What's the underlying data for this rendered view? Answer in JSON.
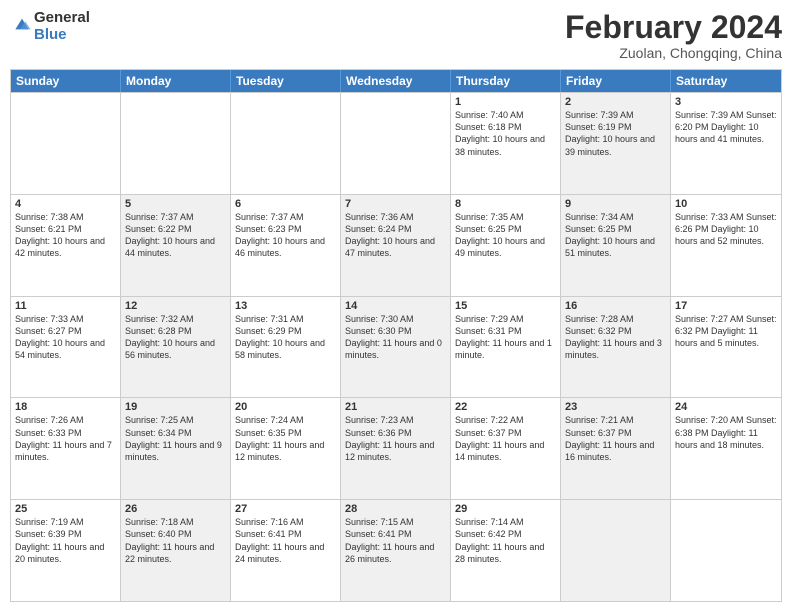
{
  "header": {
    "logo_general": "General",
    "logo_blue": "Blue",
    "title": "February 2024",
    "subtitle": "Zuolan, Chongqing, China"
  },
  "days_of_week": [
    "Sunday",
    "Monday",
    "Tuesday",
    "Wednesday",
    "Thursday",
    "Friday",
    "Saturday"
  ],
  "rows": [
    [
      {
        "day": "",
        "info": "",
        "shaded": false
      },
      {
        "day": "",
        "info": "",
        "shaded": false
      },
      {
        "day": "",
        "info": "",
        "shaded": false
      },
      {
        "day": "",
        "info": "",
        "shaded": false
      },
      {
        "day": "1",
        "info": "Sunrise: 7:40 AM\nSunset: 6:18 PM\nDaylight: 10 hours and 38 minutes.",
        "shaded": false
      },
      {
        "day": "2",
        "info": "Sunrise: 7:39 AM\nSunset: 6:19 PM\nDaylight: 10 hours and 39 minutes.",
        "shaded": true
      },
      {
        "day": "3",
        "info": "Sunrise: 7:39 AM\nSunset: 6:20 PM\nDaylight: 10 hours and 41 minutes.",
        "shaded": false
      }
    ],
    [
      {
        "day": "4",
        "info": "Sunrise: 7:38 AM\nSunset: 6:21 PM\nDaylight: 10 hours and 42 minutes.",
        "shaded": false
      },
      {
        "day": "5",
        "info": "Sunrise: 7:37 AM\nSunset: 6:22 PM\nDaylight: 10 hours and 44 minutes.",
        "shaded": true
      },
      {
        "day": "6",
        "info": "Sunrise: 7:37 AM\nSunset: 6:23 PM\nDaylight: 10 hours and 46 minutes.",
        "shaded": false
      },
      {
        "day": "7",
        "info": "Sunrise: 7:36 AM\nSunset: 6:24 PM\nDaylight: 10 hours and 47 minutes.",
        "shaded": true
      },
      {
        "day": "8",
        "info": "Sunrise: 7:35 AM\nSunset: 6:25 PM\nDaylight: 10 hours and 49 minutes.",
        "shaded": false
      },
      {
        "day": "9",
        "info": "Sunrise: 7:34 AM\nSunset: 6:25 PM\nDaylight: 10 hours and 51 minutes.",
        "shaded": true
      },
      {
        "day": "10",
        "info": "Sunrise: 7:33 AM\nSunset: 6:26 PM\nDaylight: 10 hours and 52 minutes.",
        "shaded": false
      }
    ],
    [
      {
        "day": "11",
        "info": "Sunrise: 7:33 AM\nSunset: 6:27 PM\nDaylight: 10 hours and 54 minutes.",
        "shaded": false
      },
      {
        "day": "12",
        "info": "Sunrise: 7:32 AM\nSunset: 6:28 PM\nDaylight: 10 hours and 56 minutes.",
        "shaded": true
      },
      {
        "day": "13",
        "info": "Sunrise: 7:31 AM\nSunset: 6:29 PM\nDaylight: 10 hours and 58 minutes.",
        "shaded": false
      },
      {
        "day": "14",
        "info": "Sunrise: 7:30 AM\nSunset: 6:30 PM\nDaylight: 11 hours and 0 minutes.",
        "shaded": true
      },
      {
        "day": "15",
        "info": "Sunrise: 7:29 AM\nSunset: 6:31 PM\nDaylight: 11 hours and 1 minute.",
        "shaded": false
      },
      {
        "day": "16",
        "info": "Sunrise: 7:28 AM\nSunset: 6:32 PM\nDaylight: 11 hours and 3 minutes.",
        "shaded": true
      },
      {
        "day": "17",
        "info": "Sunrise: 7:27 AM\nSunset: 6:32 PM\nDaylight: 11 hours and 5 minutes.",
        "shaded": false
      }
    ],
    [
      {
        "day": "18",
        "info": "Sunrise: 7:26 AM\nSunset: 6:33 PM\nDaylight: 11 hours and 7 minutes.",
        "shaded": false
      },
      {
        "day": "19",
        "info": "Sunrise: 7:25 AM\nSunset: 6:34 PM\nDaylight: 11 hours and 9 minutes.",
        "shaded": true
      },
      {
        "day": "20",
        "info": "Sunrise: 7:24 AM\nSunset: 6:35 PM\nDaylight: 11 hours and 12 minutes.",
        "shaded": false
      },
      {
        "day": "21",
        "info": "Sunrise: 7:23 AM\nSunset: 6:36 PM\nDaylight: 11 hours and 12 minutes.",
        "shaded": true
      },
      {
        "day": "22",
        "info": "Sunrise: 7:22 AM\nSunset: 6:37 PM\nDaylight: 11 hours and 14 minutes.",
        "shaded": false
      },
      {
        "day": "23",
        "info": "Sunrise: 7:21 AM\nSunset: 6:37 PM\nDaylight: 11 hours and 16 minutes.",
        "shaded": true
      },
      {
        "day": "24",
        "info": "Sunrise: 7:20 AM\nSunset: 6:38 PM\nDaylight: 11 hours and 18 minutes.",
        "shaded": false
      }
    ],
    [
      {
        "day": "25",
        "info": "Sunrise: 7:19 AM\nSunset: 6:39 PM\nDaylight: 11 hours and 20 minutes.",
        "shaded": false
      },
      {
        "day": "26",
        "info": "Sunrise: 7:18 AM\nSunset: 6:40 PM\nDaylight: 11 hours and 22 minutes.",
        "shaded": true
      },
      {
        "day": "27",
        "info": "Sunrise: 7:16 AM\nSunset: 6:41 PM\nDaylight: 11 hours and 24 minutes.",
        "shaded": false
      },
      {
        "day": "28",
        "info": "Sunrise: 7:15 AM\nSunset: 6:41 PM\nDaylight: 11 hours and 26 minutes.",
        "shaded": true
      },
      {
        "day": "29",
        "info": "Sunrise: 7:14 AM\nSunset: 6:42 PM\nDaylight: 11 hours and 28 minutes.",
        "shaded": false
      },
      {
        "day": "",
        "info": "",
        "shaded": true
      },
      {
        "day": "",
        "info": "",
        "shaded": false
      }
    ]
  ]
}
